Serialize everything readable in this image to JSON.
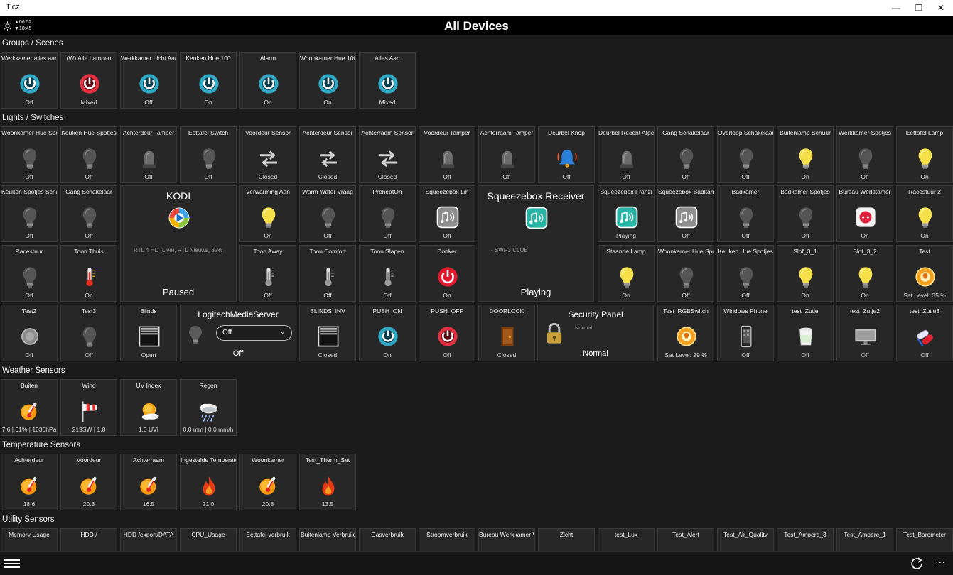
{
  "window": {
    "app_title": "Ticz",
    "min_icon": "minimize-icon",
    "max_icon": "restore-icon",
    "close_icon": "close-icon"
  },
  "header": {
    "sunrise": "▲06:52",
    "sunset": "▼18:45",
    "title": "All Devices",
    "sun_icon": "sun-icon"
  },
  "sections": {
    "groups": "Groups / Scenes",
    "lights": "Lights / Switches",
    "weather": "Weather Sensors",
    "temperature": "Temperature Sensors",
    "utility": "Utility Sensors"
  },
  "groups": [
    {
      "name": "Werkkamer alles aan",
      "status": "Off",
      "icon": "scene-cyan-icon"
    },
    {
      "name": "(W) Alle Lampen",
      "status": "Mixed",
      "icon": "scene-red-icon"
    },
    {
      "name": "Werkkamer Licht Aan",
      "status": "Off",
      "icon": "scene-cyan-icon"
    },
    {
      "name": "Keuken Hue 100",
      "status": "On",
      "icon": "scene-cyan-icon"
    },
    {
      "name": "Alarm",
      "status": "On",
      "icon": "scene-cyan-icon"
    },
    {
      "name": "Woonkamer Hue 100",
      "status": "On",
      "icon": "scene-cyan-icon"
    },
    {
      "name": "Alles Aan",
      "status": "Mixed",
      "icon": "scene-cyan-icon"
    }
  ],
  "lights_row1": [
    {
      "name": "Woonkamer Hue Spotjes",
      "status": "Off",
      "icon": "bulb-off-icon"
    },
    {
      "name": "Keuken Hue Spotjes",
      "status": "Off",
      "icon": "bulb-off-icon"
    },
    {
      "name": "Achterdeur Tamper",
      "status": "Off",
      "icon": "siren-icon"
    },
    {
      "name": "Eettafel Switch",
      "status": "Off",
      "icon": "bulb-off-icon"
    },
    {
      "name": "Voordeur Sensor",
      "status": "Closed",
      "icon": "arrows-icon"
    },
    {
      "name": "Achterdeur Sensor",
      "status": "Closed",
      "icon": "arrows-icon"
    },
    {
      "name": "Achterraam Sensor",
      "status": "Closed",
      "icon": "arrows-icon"
    },
    {
      "name": "Voordeur Tamper",
      "status": "Off",
      "icon": "siren-icon"
    },
    {
      "name": "Achterraam Tamper",
      "status": "Off",
      "icon": "siren-icon"
    },
    {
      "name": "Deurbel Knop",
      "status": "Off",
      "icon": "doorbell-icon"
    },
    {
      "name": "Deurbel Recent Afgegaan",
      "status": "Off",
      "icon": "siren-icon"
    },
    {
      "name": "Gang Schakelaar",
      "status": "Off",
      "icon": "bulb-off-icon"
    },
    {
      "name": "Overloop Schakelaar",
      "status": "Off",
      "icon": "bulb-off-icon"
    },
    {
      "name": "Buitenlamp Schuur",
      "status": "On",
      "icon": "bulb-on-icon"
    },
    {
      "name": "Werkkamer Spotjes",
      "status": "Off",
      "icon": "bulb-off-icon"
    },
    {
      "name": "Eettafel Lamp",
      "status": "On",
      "icon": "bulb-on-icon"
    }
  ],
  "lights_row2": [
    {
      "name": "Keuken Spotjes Schakelaar",
      "status": "Off",
      "icon": "bulb-off-icon"
    },
    {
      "name": "Gang Schakelaar",
      "status": "Off",
      "icon": "bulb-off-icon"
    },
    {
      "name": "Verwarming Aan",
      "status": "On",
      "icon": "bulb-on-icon"
    },
    {
      "name": "Warm Water Vraag",
      "status": "Off",
      "icon": "bulb-off-icon"
    },
    {
      "name": "PreheatOn",
      "status": "Off",
      "icon": "bulb-off-icon"
    },
    {
      "name": "Squeezebox Lin",
      "status": "Off",
      "icon": "music-grey-icon"
    },
    {
      "name": "Squeezebox Franzl",
      "status": "Playing",
      "icon": "music-teal-icon"
    },
    {
      "name": "Squeezebox Badkamer",
      "status": "Off",
      "icon": "music-grey-icon"
    },
    {
      "name": "Badkamer",
      "status": "Off",
      "icon": "bulb-off-icon"
    },
    {
      "name": "Badkamer Spotjes",
      "status": "Off",
      "icon": "bulb-off-icon"
    },
    {
      "name": "Bureau Werkkamer",
      "status": "On",
      "icon": "socket-icon"
    },
    {
      "name": "Racestuur 2",
      "status": "On",
      "icon": "bulb-on-icon"
    }
  ],
  "lights_row3": [
    {
      "name": "Racestuur",
      "status": "Off",
      "icon": "bulb-off-icon"
    },
    {
      "name": "Toon Thuis",
      "status": "On",
      "icon": "thermo-red-icon"
    },
    {
      "name": "Toon Away",
      "status": "Off",
      "icon": "thermo-grey-icon"
    },
    {
      "name": "Toon Comfort",
      "status": "Off",
      "icon": "thermo-grey-icon"
    },
    {
      "name": "Toon Slapen",
      "status": "Off",
      "icon": "thermo-grey-icon"
    },
    {
      "name": "Donker",
      "status": "On",
      "icon": "power-red-icon"
    },
    {
      "name": "Staande Lamp",
      "status": "On",
      "icon": "bulb-on-icon"
    },
    {
      "name": "Woonkamer Hue Spotjes",
      "status": "Off",
      "icon": "bulb-off-icon"
    },
    {
      "name": "Keuken Hue Spotjes",
      "status": "Off",
      "icon": "bulb-off-icon"
    },
    {
      "name": "Slof_3_1",
      "status": "On",
      "icon": "bulb-on-icon"
    },
    {
      "name": "Slof_3_2",
      "status": "On",
      "icon": "bulb-on-icon"
    },
    {
      "name": "Test",
      "status": "Set Level: 35 %",
      "icon": "dimmer-icon"
    }
  ],
  "lights_row4": [
    {
      "name": "Test2",
      "status": "Off",
      "icon": "dimmer-grey-icon"
    },
    {
      "name": "Test3",
      "status": "Off",
      "icon": "bulb-off-icon"
    },
    {
      "name": "Blinds",
      "status": "Open",
      "icon": "blinds-icon"
    },
    {
      "name": "BLINDS_INV",
      "status": "Closed",
      "icon": "blinds-icon"
    },
    {
      "name": "PUSH_ON",
      "status": "On",
      "icon": "scene-cyan-icon"
    },
    {
      "name": "PUSH_OFF",
      "status": "Off",
      "icon": "scene-red-icon"
    },
    {
      "name": "DOORLOCK",
      "status": "Closed",
      "icon": "door-icon"
    },
    {
      "name": "Test_RGBSwitch",
      "status": "Set Level: 29 %",
      "icon": "dimmer-icon"
    },
    {
      "name": "Windows Phone",
      "status": "Off",
      "icon": "phone-icon"
    },
    {
      "name": "test_Zutje",
      "status": "Off",
      "icon": "cup-icon"
    },
    {
      "name": "test_Zutje2",
      "status": "Off",
      "icon": "tv-icon"
    },
    {
      "name": "test_Zutje3",
      "status": "Off",
      "icon": "pills-icon"
    }
  ],
  "kodi": {
    "title": "KODI",
    "sub": "RTL 4 HD (Live), RTL Nieuws, 32%",
    "status": "Paused",
    "icon": "kodi-icon"
  },
  "squeezebox": {
    "title": "Squeezebox Receiver",
    "sub": "- SWR3 CLUB",
    "status": "Playing",
    "icon": "music-teal-icon"
  },
  "lms": {
    "title": "LogitechMediaServer",
    "selected": "Off",
    "status": "Off",
    "icon": "bulb-off-icon",
    "chevron": "chevron-down-icon"
  },
  "security": {
    "title": "Security Panel",
    "sub": "Normal",
    "status": "Normal",
    "icon": "padlock-icon"
  },
  "weather": [
    {
      "name": "Buiten",
      "status": "7.6 | 61% | 1030hPa",
      "icon": "temp-icon"
    },
    {
      "name": "Wind",
      "status": "219SW | 1.8",
      "icon": "windsock-icon"
    },
    {
      "name": "UV Index",
      "status": "1.0 UVI",
      "icon": "uv-sun-icon"
    },
    {
      "name": "Regen",
      "status": "0.0 mm | 0.0 mm/h",
      "icon": "rain-icon"
    }
  ],
  "temperature": [
    {
      "name": "Achterdeur",
      "status": "18.6",
      "icon": "temp-icon"
    },
    {
      "name": "Voordeur",
      "status": "20.3",
      "icon": "temp-icon"
    },
    {
      "name": "Achterraam",
      "status": "16.5",
      "icon": "temp-icon"
    },
    {
      "name": "Ingestelde Temperatuur",
      "status": "21.0",
      "icon": "flame-icon"
    },
    {
      "name": "Woonkamer",
      "status": "20.8",
      "icon": "temp-icon"
    },
    {
      "name": "Test_Therm_Set",
      "status": "13.5",
      "icon": "flame-icon"
    }
  ],
  "utility": [
    {
      "name": "Memory Usage",
      "icon": "gauge-icon"
    },
    {
      "name": "HDD /",
      "icon": "gauge-icon"
    },
    {
      "name": "HDD /export/DATA",
      "icon": "gauge-icon"
    },
    {
      "name": "CPU_Usage",
      "icon": "gauge-icon"
    },
    {
      "name": "Eettafel verbruik",
      "icon": "energy-icon"
    },
    {
      "name": "Buitenlamp Verbruik",
      "icon": "energy-icon"
    },
    {
      "name": "Gasverbruik",
      "icon": "energy-icon"
    },
    {
      "name": "Stroomverbruik",
      "icon": "energy-icon"
    },
    {
      "name": "Bureau Werkkamer Verbruik",
      "icon": "energy-icon"
    },
    {
      "name": "Zicht",
      "icon": "visibility-icon"
    },
    {
      "name": "test_Lux",
      "icon": "lux-icon"
    },
    {
      "name": "Test_Alert",
      "icon": "alert-icon"
    },
    {
      "name": "Test_Air_Quality",
      "icon": "air-icon"
    },
    {
      "name": "Test_Ampere_3",
      "icon": "ampere-icon"
    },
    {
      "name": "Test_Ampere_1",
      "icon": "ampere-icon"
    },
    {
      "name": "Test_Barometer",
      "icon": "barometer-icon"
    }
  ],
  "bottom": {
    "menu_icon": "hamburger-menu-icon",
    "refresh_icon": "refresh-icon",
    "more_icon": "more-icon",
    "more_label": "···"
  }
}
